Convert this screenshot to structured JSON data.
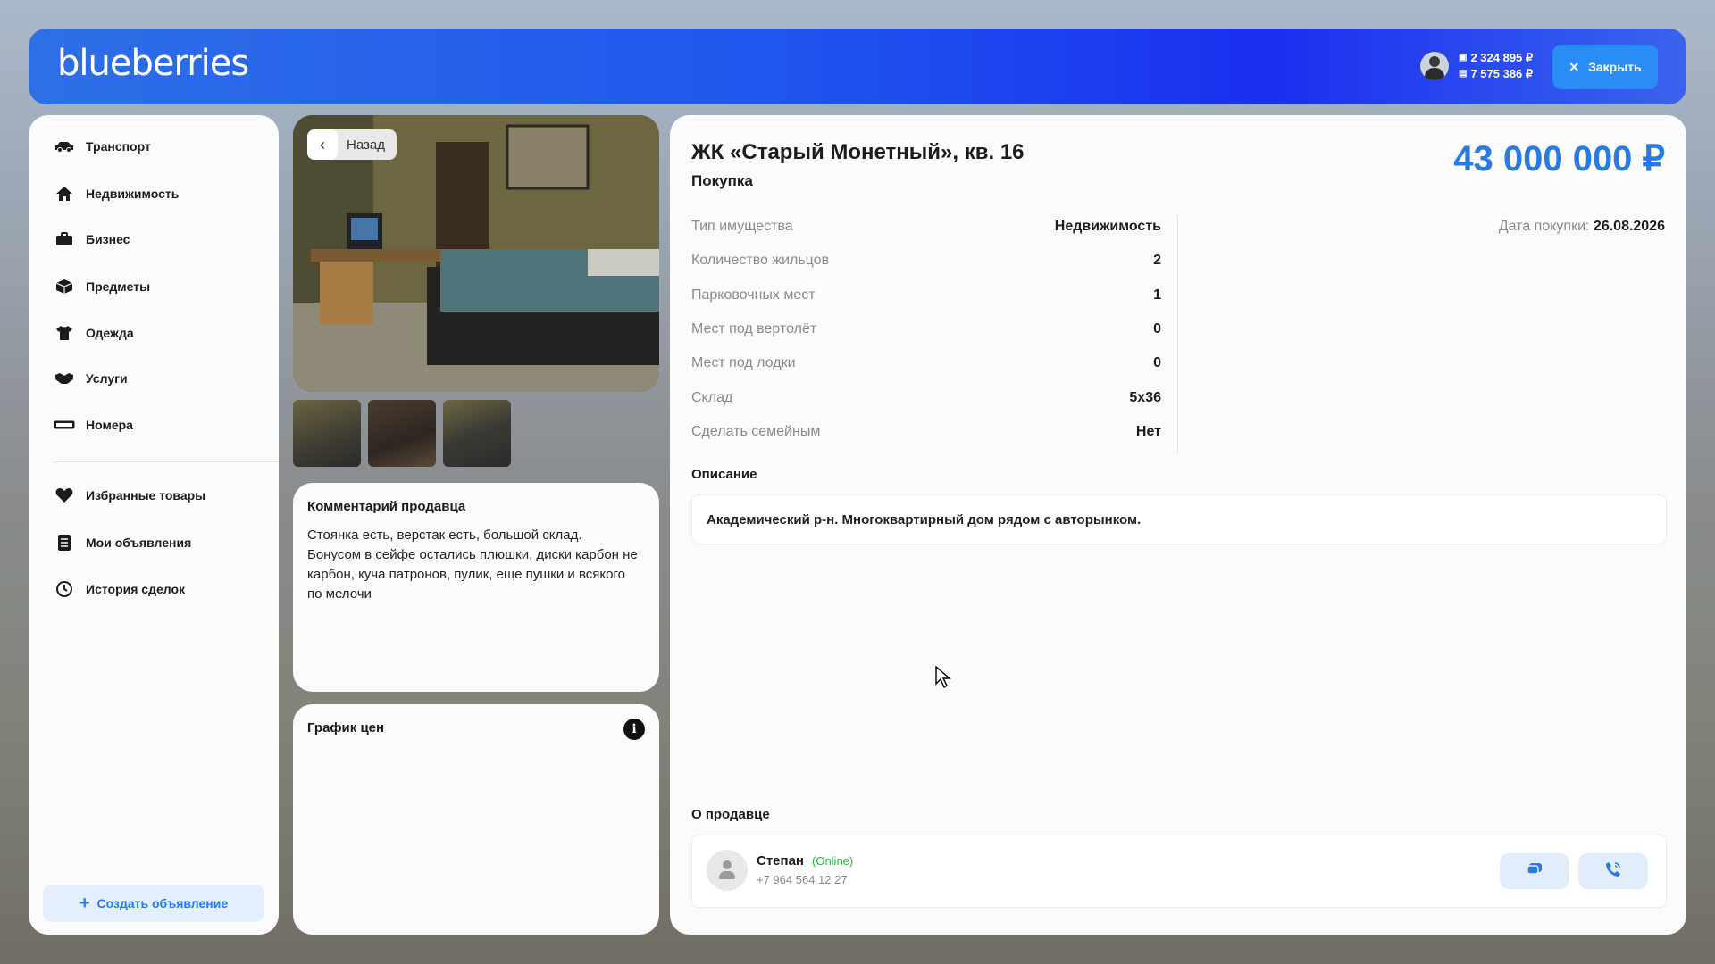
{
  "header": {
    "logo": "blueberries",
    "balance_cash": "2 324 895 ₽",
    "balance_bank": "7 575 386 ₽",
    "close_label": "Закрыть"
  },
  "sidebar": {
    "items": [
      {
        "label": "Транспорт",
        "icon": "car-icon"
      },
      {
        "label": "Недвижимость",
        "icon": "home-icon"
      },
      {
        "label": "Бизнес",
        "icon": "briefcase-icon"
      },
      {
        "label": "Предметы",
        "icon": "box-icon"
      },
      {
        "label": "Одежда",
        "icon": "shirt-icon"
      },
      {
        "label": "Услуги",
        "icon": "handshake-icon"
      },
      {
        "label": "Номера",
        "icon": "plate-icon"
      }
    ],
    "secondary": [
      {
        "label": "Избранные товары",
        "icon": "heart-icon"
      },
      {
        "label": "Мои объявления",
        "icon": "list-icon"
      },
      {
        "label": "История сделок",
        "icon": "history-icon"
      }
    ],
    "create_label": "Создать объявление"
  },
  "gallery": {
    "back_label": "Назад"
  },
  "comment": {
    "title": "Комментарий продавца",
    "text": "Стоянка есть, верстак есть, большой склад. Бонусом в сейфе остались плюшки, диски карбон не карбон, куча патронов, пулик, еще пушки и всякого по мелочи"
  },
  "price_chart": {
    "title": "График цен"
  },
  "listing": {
    "title": "ЖК «Старый Монетный», кв. 16",
    "subtitle": "Покупка",
    "price": "43 000 000 ₽",
    "purchase_date_label": "Дата покупки:",
    "purchase_date": "26.08.2026",
    "properties": [
      {
        "key": "Тип имущества",
        "value": "Недвижимость"
      },
      {
        "key": "Количество жильцов",
        "value": "2"
      },
      {
        "key": "Парковочных мест",
        "value": "1"
      },
      {
        "key": "Мест под вертолёт",
        "value": "0"
      },
      {
        "key": "Мест под лодки",
        "value": "0"
      },
      {
        "key": "Склад",
        "value": "5x36"
      },
      {
        "key": "Сделать семейным",
        "value": "Нет"
      }
    ],
    "description_title": "Описание",
    "description": "Академический р-н. Многоквартирный дом рядом с авторынком."
  },
  "seller": {
    "section_title": "О продавце",
    "name": "Степан",
    "status": "(Online)",
    "phone": "+7 964 564 12 27"
  },
  "colors": {
    "accent": "#2a7ae4",
    "online": "#2bb33b"
  }
}
